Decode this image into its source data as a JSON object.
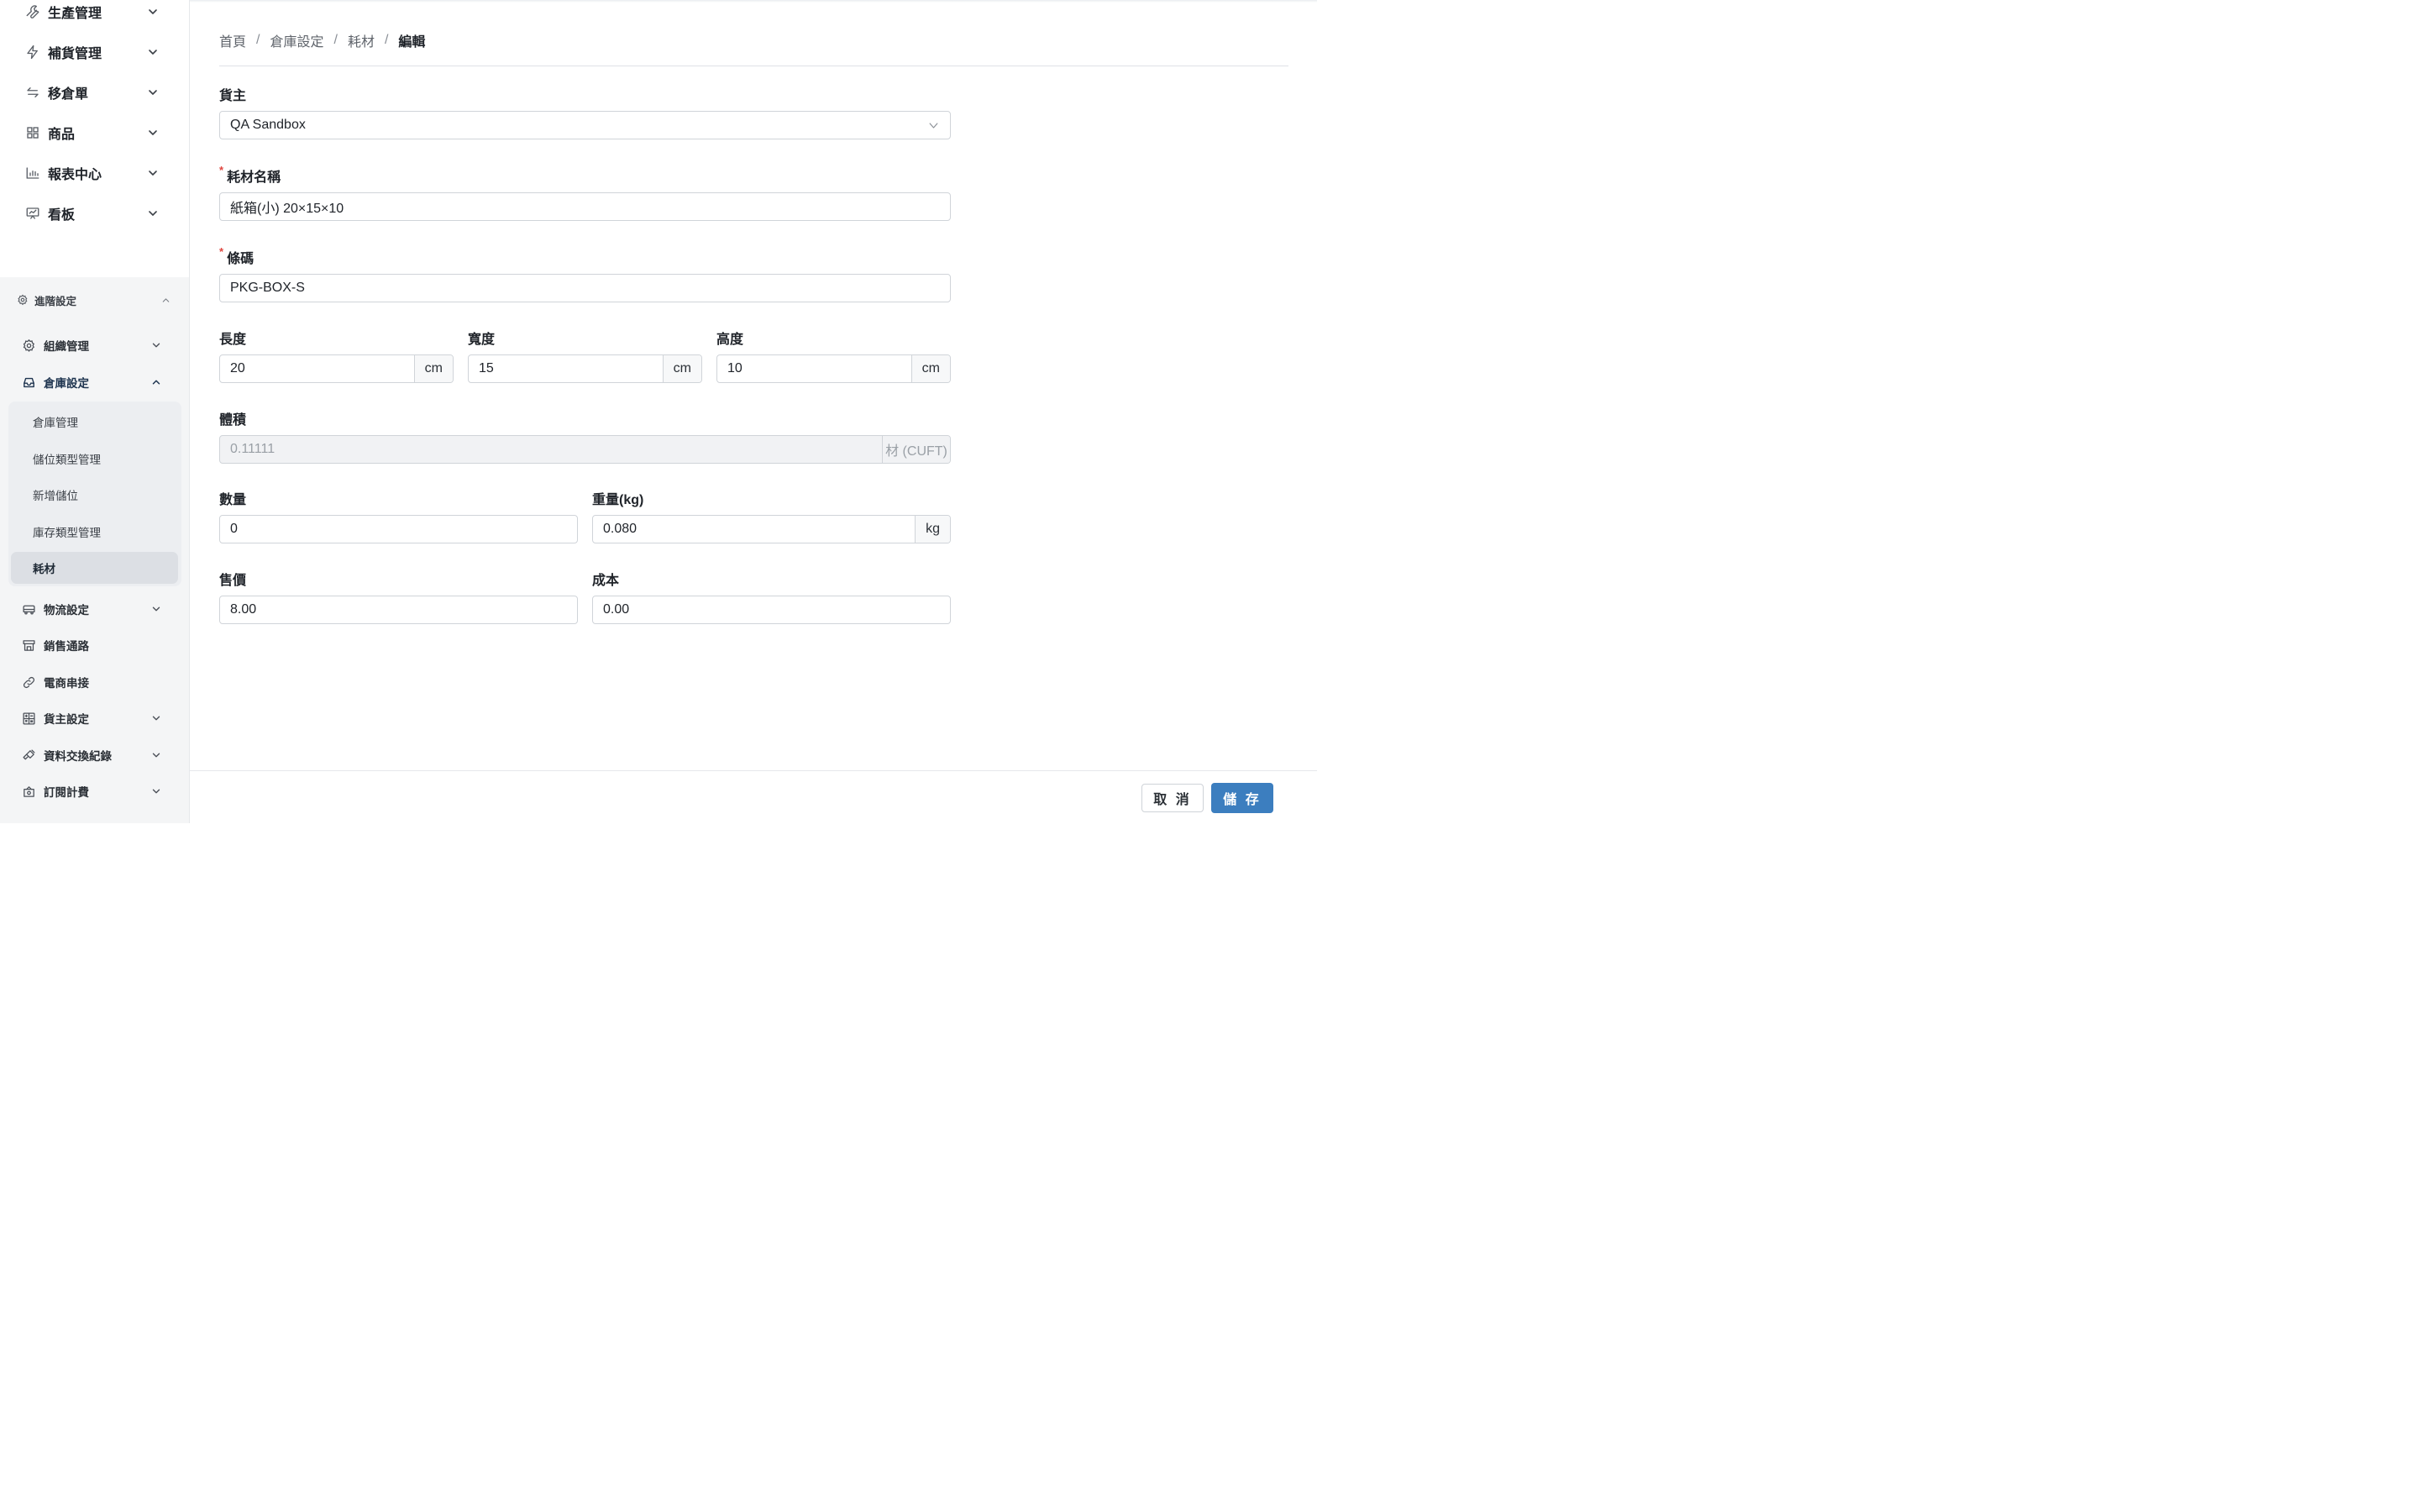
{
  "sidebar": {
    "top_items": [
      {
        "label": "生產管理",
        "icon": "wrench-icon"
      },
      {
        "label": "補貨管理",
        "icon": "lightning-icon"
      },
      {
        "label": "移倉單",
        "icon": "transfer-arrows-icon"
      },
      {
        "label": "商品",
        "icon": "grid-icon"
      },
      {
        "label": "報表中心",
        "icon": "bar-chart-icon"
      },
      {
        "label": "看板",
        "icon": "dashboard-board-icon"
      }
    ],
    "advanced": {
      "label": "進階設定",
      "items": [
        {
          "label": "組織管理",
          "icon": "gear-icon"
        },
        {
          "label": "倉庫設定",
          "icon": "inbox-icon"
        },
        {
          "label": "物流設定",
          "icon": "truck-icon"
        },
        {
          "label": "銷售通路",
          "icon": "store-icon"
        },
        {
          "label": "電商串接",
          "icon": "link-icon"
        },
        {
          "label": "貨主設定",
          "icon": "calculator-icon"
        },
        {
          "label": "資料交換紀錄",
          "icon": "plug-icon"
        },
        {
          "label": "訂閱計費",
          "icon": "subscription-icon"
        }
      ],
      "warehouse_submenu": [
        "倉庫管理",
        "儲位類型管理",
        "新增儲位",
        "庫存類型管理",
        "耗材"
      ]
    }
  },
  "breadcrumb": [
    "首頁",
    "倉庫設定",
    "耗材",
    "編輯"
  ],
  "form": {
    "owner": {
      "label": "貨主",
      "value": "QA Sandbox"
    },
    "name": {
      "label": "耗材名稱",
      "required_mark": "*",
      "value": "紙箱(小) 20×15×10"
    },
    "barcode": {
      "label": "條碼",
      "required_mark": "*",
      "value": "PKG-BOX-S"
    },
    "length": {
      "label": "長度",
      "value": "20",
      "unit": "cm"
    },
    "width": {
      "label": "寬度",
      "value": "15",
      "unit": "cm"
    },
    "height": {
      "label": "高度",
      "value": "10",
      "unit": "cm"
    },
    "volume": {
      "label": "體積",
      "value": "0.11111",
      "unit": "材 (CUFT)"
    },
    "quantity": {
      "label": "數量",
      "value": "0"
    },
    "weight": {
      "label": "重量(kg)",
      "value": "0.080",
      "unit": "kg"
    },
    "price": {
      "label": "售價",
      "value": "8.00"
    },
    "cost": {
      "label": "成本",
      "value": "0.00"
    }
  },
  "footer": {
    "cancel_label": "取 消",
    "save_label": "儲 存"
  },
  "colors": {
    "primary": "#3c7ebf",
    "required": "#e0463f",
    "sidebar_bg": "#f4f5f6"
  }
}
